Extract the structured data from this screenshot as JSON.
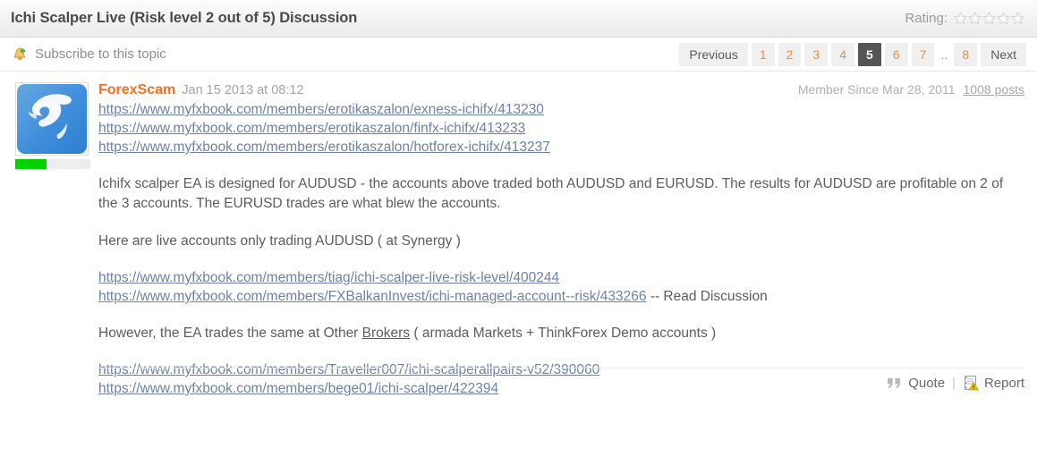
{
  "header": {
    "title": "Ichi Scalper Live (Risk level 2 out of 5) Discussion",
    "rating_label": "Rating:",
    "rating_stars": 5,
    "rating_filled": 0,
    "star_icon": "star-outline-icon"
  },
  "subbar": {
    "subscribe_label": "Subscribe to this topic",
    "bell_icon": "bell-add-icon",
    "pagination": {
      "previous_label": "Previous",
      "next_label": "Next",
      "ellipsis": "..",
      "pages": [
        "1",
        "2",
        "3",
        "4",
        "5",
        "6",
        "7"
      ],
      "last_page": "8",
      "active_page": "5"
    }
  },
  "post": {
    "avatar_icon": "bull-avatar-image",
    "progress_percent": 42,
    "username": "ForexScam",
    "date": "Jan 15 2013 at 08:12",
    "member_since": "Member Since Mar 28, 2011",
    "post_count": "1008 posts",
    "top_links": [
      "https://www.myfxbook.com/members/erotikaszalon/exness-ichifx/413230",
      "https://www.myfxbook.com/members/erotikaszalon/finfx-ichifx/413233",
      "https://www.myfxbook.com/members/erotikaszalon/hotforex-ichifx/413237"
    ],
    "paragraph1": "Ichifx scalper EA is designed for AUDUSD - the accounts above traded both AUDUSD and EURUSD. The results for AUDUSD are profitable on 2 of the 3 accounts. The EURUSD trades are what blew the accounts.",
    "paragraph2": "Here are live accounts only trading AUDUSD ( at Synergy )",
    "mid_link1": "https://www.myfxbook.com/members/tiag/ichi-scalper-live-risk-level/400244",
    "mid_link2": "https://www.myfxbook.com/members/FXBalkanInvest/ichi-managed-account--risk/433266",
    "mid_link2_suffix": " -- Read Discussion",
    "paragraph3_before": "However, the EA trades the same at Other ",
    "paragraph3_link": "Brokers",
    "paragraph3_after": " ( armada Markets + ThinkForex Demo accounts )",
    "bottom_links": [
      "https://www.myfxbook.com/members/Traveller007/ichi-scalperallpairs-v52/390060",
      "https://www.myfxbook.com/members/bege01/ichi-scalper/422394"
    ]
  },
  "footer": {
    "quote_label": "Quote",
    "quote_icon": "quotation-mark-icon",
    "separator": "|",
    "report_label": "Report",
    "report_icon": "report-warning-icon"
  },
  "colors": {
    "username_orange": "#f47121",
    "link_blue": "#6f82a6",
    "active_page_bg": "#555555",
    "progress_green": "#00d200"
  }
}
